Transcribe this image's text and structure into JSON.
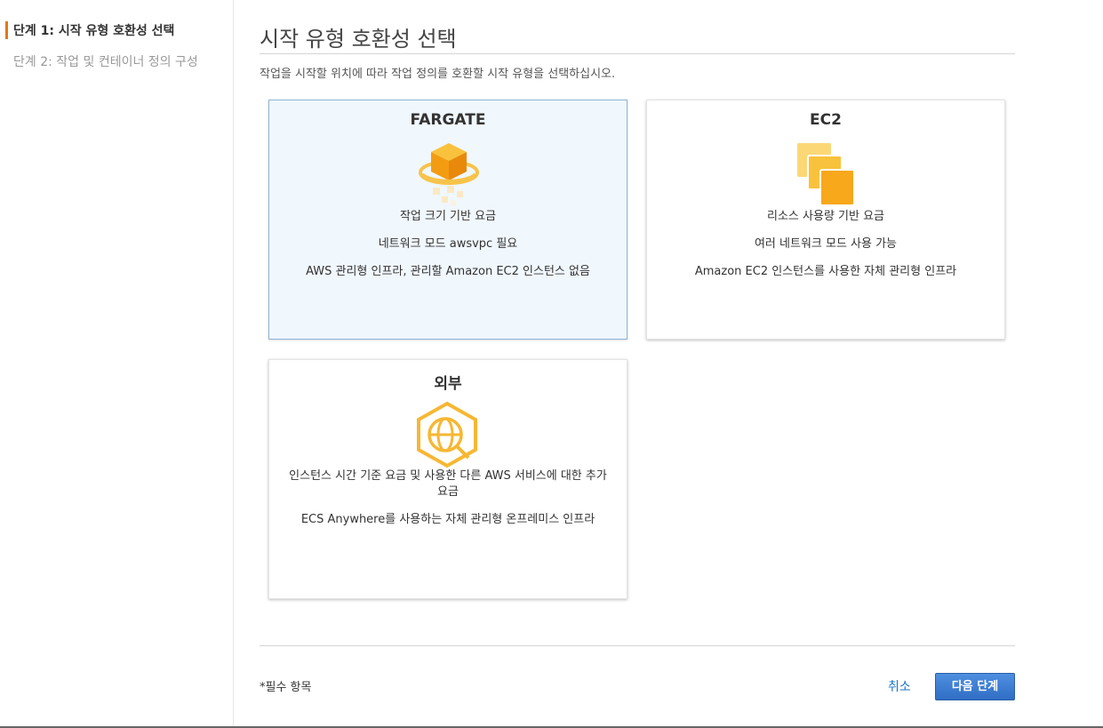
{
  "sidebar": {
    "steps": [
      {
        "label": "단계 1: 시작 유형 호환성 선택"
      },
      {
        "label": "단계 2: 작업 및 컨테이너 정의 구성"
      }
    ]
  },
  "main": {
    "title": "시작 유형 호환성 선택",
    "description": "작업을 시작할 위치에 따라 작업 정의를 호환할 시작 유형을 선택하십시오."
  },
  "cards": [
    {
      "title": "FARGATE",
      "icon": "fargate-icon",
      "selected": true,
      "lines": [
        "작업 크기 기반 요금",
        "네트워크 모드 awsvpc 필요",
        "AWS 관리형 인프라, 관리할 Amazon EC2 인스턴스 없음"
      ]
    },
    {
      "title": "EC2",
      "icon": "ec2-icon",
      "selected": false,
      "lines": [
        "리소스 사용량 기반 요금",
        "여러 네트워크 모드 사용 가능",
        "Amazon EC2 인스턴스를 사용한 자체 관리형 인프라"
      ]
    },
    {
      "title": "외부",
      "icon": "external-icon",
      "selected": false,
      "lines": [
        "인스턴스 시간 기준 요금 및 사용한 다른 AWS 서비스에 대한 추가 요금",
        "ECS Anywhere를 사용하는 자체 관리형 온프레미스 인프라"
      ]
    }
  ],
  "footer": {
    "required_note": "*필수 항목",
    "cancel_label": "취소",
    "next_label": "다음 단계"
  },
  "colors": {
    "accent": "#e07b00",
    "link": "#1a73c8",
    "primary_button": "#2f6ec4",
    "selected_card_bg": "#f0f7fd",
    "icon_orange": "#f7a81b"
  }
}
